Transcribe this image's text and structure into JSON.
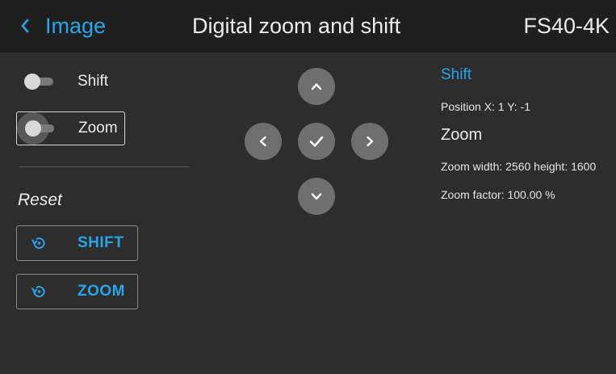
{
  "header": {
    "back_label": "Image",
    "title": "Digital zoom and shift",
    "model": "FS40-4K"
  },
  "toggles": [
    {
      "label": "Shift",
      "enabled": false,
      "selected": false
    },
    {
      "label": "Zoom",
      "enabled": false,
      "selected": true
    }
  ],
  "reset": {
    "title": "Reset",
    "buttons": [
      {
        "label": "SHIFT"
      },
      {
        "label": "ZOOM"
      }
    ]
  },
  "dpad": {
    "up_icon": "chevron-up-icon",
    "down_icon": "chevron-down-icon",
    "left_icon": "chevron-left-icon",
    "right_icon": "chevron-right-icon",
    "center_icon": "check-icon"
  },
  "info": {
    "shift_heading": "Shift",
    "position_text": "Position X: 1 Y: -1",
    "zoom_heading": "Zoom",
    "zoom_size_text": "Zoom width: 2560 height: 1600",
    "zoom_factor_text": "Zoom factor: 100.00 %"
  },
  "colors": {
    "accent": "#2aa4e8",
    "background": "#2d2d2d",
    "header_background": "#1f1f1f",
    "button_circle": "#6f6f6f"
  }
}
